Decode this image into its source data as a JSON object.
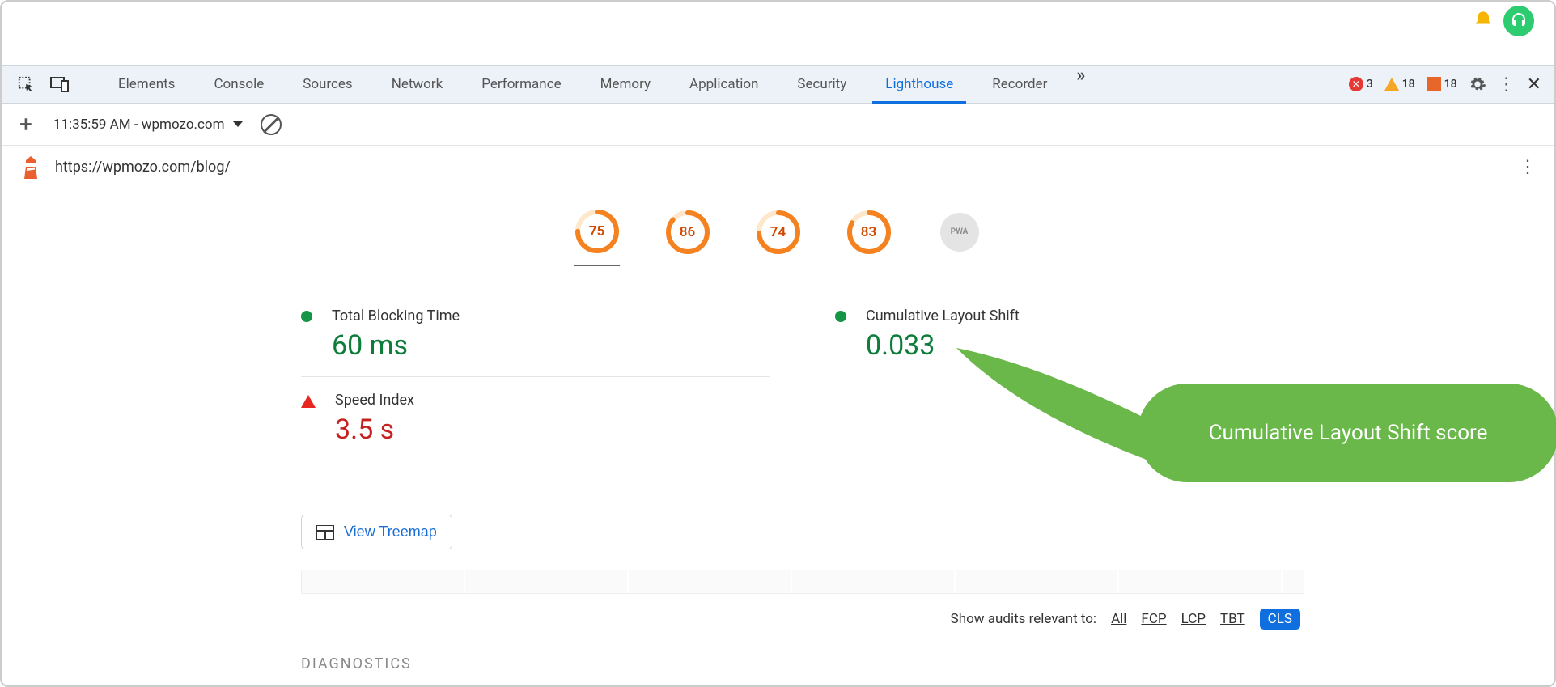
{
  "devtools_tabs": [
    "Elements",
    "Console",
    "Sources",
    "Network",
    "Performance",
    "Memory",
    "Application",
    "Security",
    "Lighthouse",
    "Recorder"
  ],
  "active_tab": "Lighthouse",
  "counts": {
    "errors": "3",
    "warnings": "18",
    "issues": "18"
  },
  "report_select": "11:35:59 AM - wpmozo.com",
  "url": "https://wpmozo.com/blog/",
  "gauges": [
    {
      "score": "75",
      "pct": 75
    },
    {
      "score": "86",
      "pct": 86
    },
    {
      "score": "74",
      "pct": 74
    },
    {
      "score": "83",
      "pct": 83
    },
    {
      "score": "PWA",
      "pct": 0,
      "grey": true
    }
  ],
  "metrics": {
    "tbt": {
      "label": "Total Blocking Time",
      "value": "60 ms"
    },
    "cls": {
      "label": "Cumulative Layout Shift",
      "value": "0.033"
    },
    "si": {
      "label": "Speed Index",
      "value": "3.5 s"
    }
  },
  "treemap_label": "View Treemap",
  "audits": {
    "label": "Show audits relevant to:",
    "filters": [
      "All",
      "FCP",
      "LCP",
      "TBT",
      "CLS"
    ],
    "active": "CLS"
  },
  "diagnostics_heading": "DIAGNOSTICS",
  "callout": "Cumulative Layout Shift score"
}
